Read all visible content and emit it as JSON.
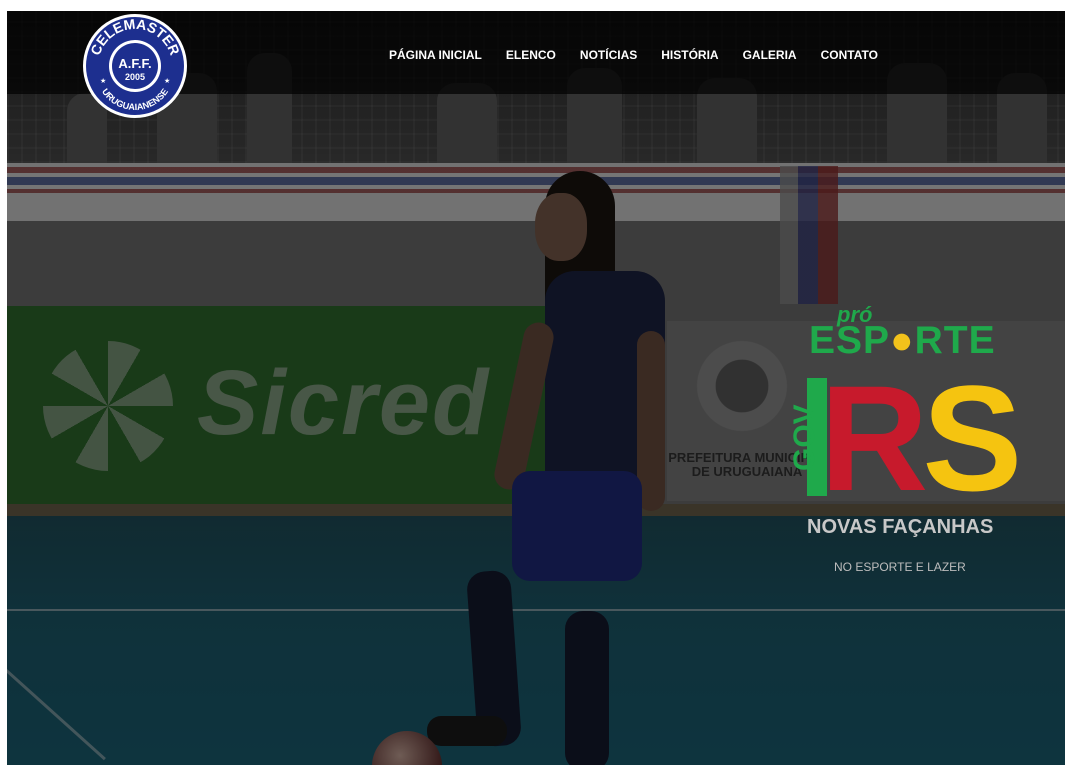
{
  "brand": {
    "logo_top": "CELEMASTER",
    "logo_center": "A.F.F.",
    "logo_year": "2005",
    "logo_bottom": "URUGUAIANENSE"
  },
  "nav": {
    "items": [
      {
        "label": "PÁGINA INICIAL"
      },
      {
        "label": "ELENCO"
      },
      {
        "label": "NOTÍCIAS"
      },
      {
        "label": "HISTÓRIA"
      },
      {
        "label": "GALERIA"
      },
      {
        "label": "CONTATO"
      }
    ]
  },
  "hero": {
    "sponsor_text": "Sicred",
    "prefeitura_line1": "PREFEITURA MUNICIPAL",
    "prefeitura_line2": "DE URUGUAIANA"
  },
  "overlay": {
    "pro": "pró",
    "esporte_a": "ESP",
    "esporte_b": "RTE",
    "gov": "GOV",
    "rs_r": "R",
    "rs_s": "S",
    "novas": "NOVAS FAÇANHAS",
    "lazer": "NO ESPORTE E LAZER"
  },
  "colors": {
    "accent_green": "#1fa94b",
    "accent_red": "#c71a2c",
    "accent_yellow": "#f5c410",
    "logo_blue": "#1d2f8f"
  }
}
